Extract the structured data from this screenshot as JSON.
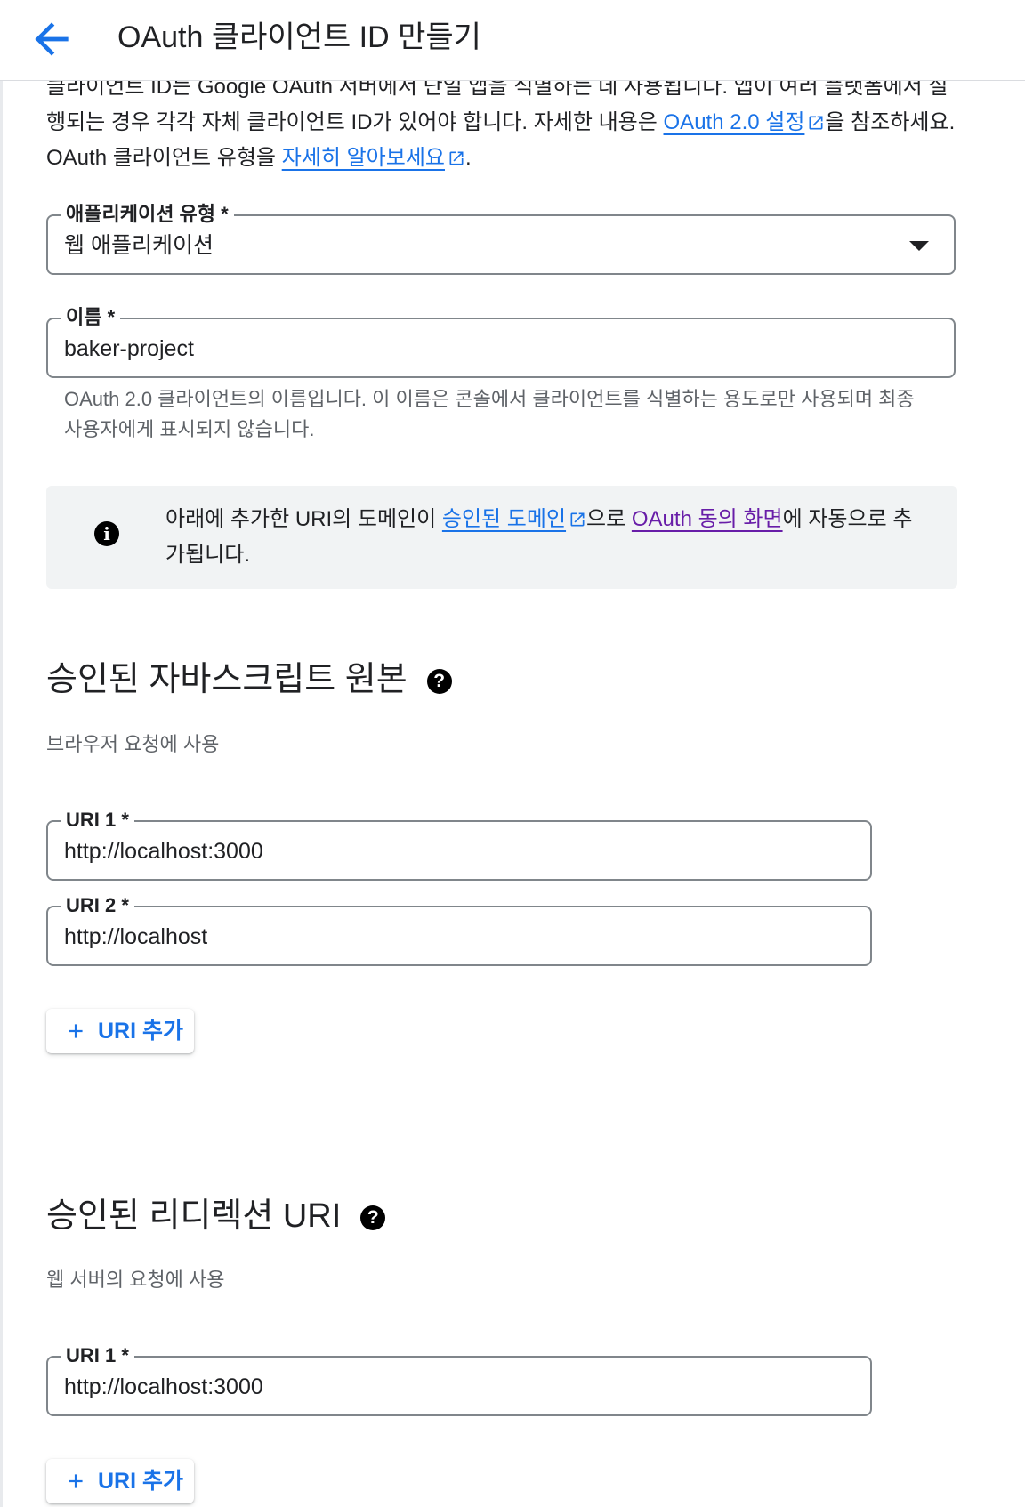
{
  "header": {
    "title": "OAuth 클라이언트 ID 만들기",
    "back_icon": "arrow-back-icon"
  },
  "intro": {
    "text_1": "클라이언트 ID는 Google OAuth 서버에서 단일 앱을 식별하는 데 사용됩니다. 앱이 여러 플랫폼에서 실행되는 경우 각각 자체 클라이언트 ID가 있어야 합니다. 자세한 내용은 ",
    "link_settings": "OAuth 2.0 설정",
    "text_2": "을 참조하세요. OAuth 클라이언트 유형을 ",
    "link_learn_more": "자세히 알아보세요",
    "text_3": "."
  },
  "app_type": {
    "label": "애플리케이션 유형 *",
    "value": "웹 애플리케이션"
  },
  "name_field": {
    "label": "이름 *",
    "value": "baker-project",
    "hint": "OAuth 2.0 클라이언트의 이름입니다. 이 이름은 콘솔에서 클라이언트를 식별하는 용도로만 사용되며 최종 사용자에게 표시되지 않습니다."
  },
  "info": {
    "icon": "info-icon",
    "text_1": "아래에 추가한 URI의 도메인이 ",
    "link_domains": "승인된 도메인",
    "text_2": "으로 ",
    "link_consent": "OAuth 동의 화면",
    "text_3": "에 자동으로 추가됩니다."
  },
  "js_origins": {
    "title": "승인된 자바스크립트 원본",
    "subtitle": "브라우저 요청에 사용",
    "uris": [
      {
        "label": "URI 1 *",
        "value": "http://localhost:3000"
      },
      {
        "label": "URI 2 *",
        "value": "http://localhost"
      }
    ],
    "add_label": "URI 추가"
  },
  "redirect_uris": {
    "title": "승인된 리디렉션 URI",
    "subtitle": "웹 서버의 요청에 사용",
    "uris": [
      {
        "label": "URI 1 *",
        "value": "http://localhost:3000"
      }
    ],
    "add_label": "URI 추가"
  },
  "colors": {
    "accent": "#1a73e8",
    "visited_link": "#681da8",
    "info_bg": "#f1f3f4",
    "border": "#80868b"
  }
}
